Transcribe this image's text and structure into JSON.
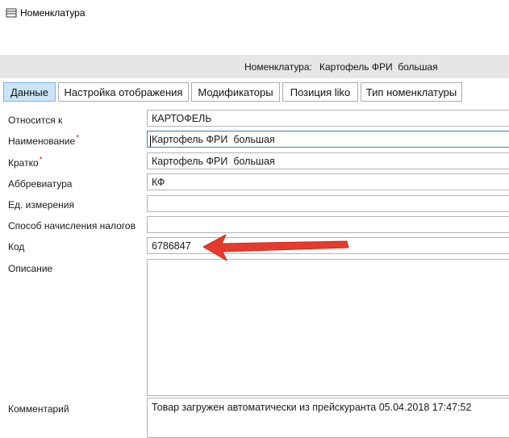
{
  "window": {
    "title": "Номенклатура",
    "icon": "table-window-icon"
  },
  "header": {
    "label": "Номенклатура:",
    "value": "Картофель ФРИ  большая"
  },
  "tabs": [
    {
      "label": "Данные",
      "active": true
    },
    {
      "label": "Настройка отображения",
      "active": false
    },
    {
      "label": "Модификаторы",
      "active": false
    },
    {
      "label": "Позиция liko",
      "active": false
    },
    {
      "label": "Тип номенклатуры",
      "active": false
    }
  ],
  "form": {
    "belongs_to": {
      "label": "Относится к",
      "value": "КАРТОФЕЛЬ"
    },
    "name": {
      "label": "Наименование",
      "required_mark": "*",
      "value": "Картофель ФРИ  большая"
    },
    "short": {
      "label": "Кратко",
      "required_mark": "*",
      "value": "Картофель ФРИ  большая"
    },
    "abbr": {
      "label": "Аббревиатура",
      "value": "КФ"
    },
    "unit": {
      "label": "Ед. измерения",
      "value": ""
    },
    "tax": {
      "label": "Способ начисления налогов",
      "value": ""
    },
    "code": {
      "label": "Код",
      "value": "6786847"
    },
    "description": {
      "label": "Описание",
      "value": ""
    },
    "comment": {
      "label": "Комментарий",
      "value": "Товар загружен автоматически из прейскуранта 05.04.2018 17:47:52"
    }
  },
  "annotation": {
    "arrow_color": "#e53b2c",
    "icon": "red-arrow-pointer"
  }
}
